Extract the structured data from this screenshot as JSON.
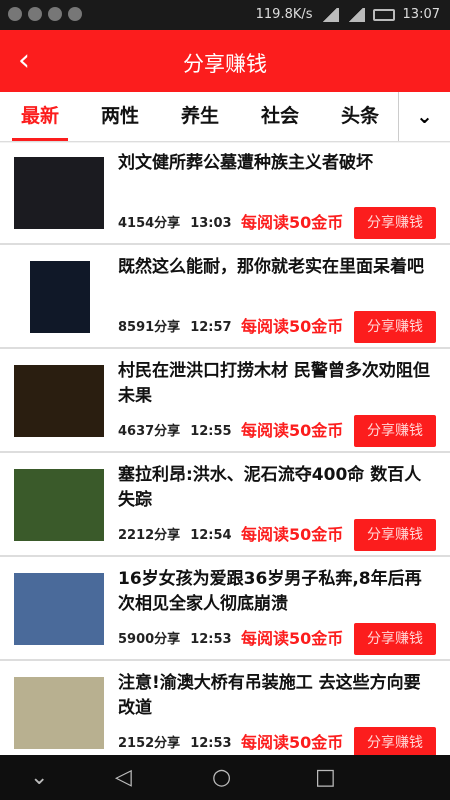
{
  "status_bar": {
    "network_speed": "119.8K/s",
    "time": "13:07"
  },
  "header": {
    "title": "分享赚钱"
  },
  "tabs": [
    "最新",
    "两性",
    "养生",
    "社会",
    "头条"
  ],
  "articles": [
    {
      "title": "刘文健所葬公墓遭种族主义者破坏",
      "shares": "4154分享",
      "time": "13:03",
      "reward": "每阅读50金币",
      "share_label": "分享赚钱"
    },
    {
      "title": "既然这么能耐，那你就老实在里面呆着吧",
      "shares": "8591分享",
      "time": "12:57",
      "reward": "每阅读50金币",
      "share_label": "分享赚钱"
    },
    {
      "title": "村民在泄洪口打捞木材 民警曾多次劝阻但未果",
      "shares": "4637分享",
      "time": "12:55",
      "reward": "每阅读50金币",
      "share_label": "分享赚钱"
    },
    {
      "title": "塞拉利昂:洪水、泥石流夺400命 数百人失踪",
      "shares": "2212分享",
      "time": "12:54",
      "reward": "每阅读50金币",
      "share_label": "分享赚钱"
    },
    {
      "title": "16岁女孩为爱跟36岁男子私奔,8年后再次相见全家人彻底崩溃",
      "shares": "5900分享",
      "time": "12:53",
      "reward": "每阅读50金币",
      "share_label": "分享赚钱"
    },
    {
      "title": "注意!渝澳大桥有吊装施工 去这些方向要改道",
      "shares": "2152分享",
      "time": "12:53",
      "reward": "每阅读50金币",
      "share_label": "分享赚钱"
    }
  ],
  "colors": {
    "accent": "#fc1d1d"
  },
  "icons": {
    "back": "chevron-left-icon",
    "more": "chevron-down-icon"
  }
}
